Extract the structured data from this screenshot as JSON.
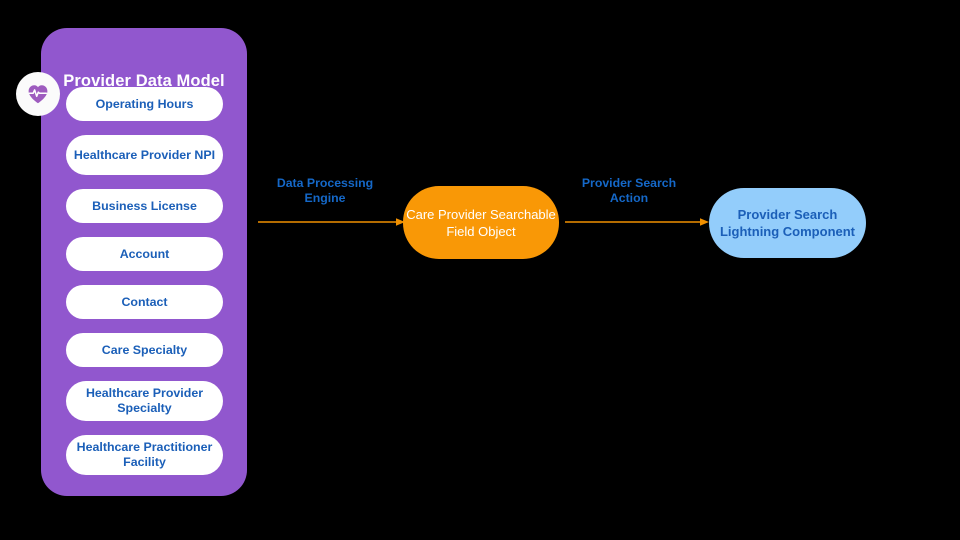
{
  "diagram": {
    "background_color": "#000000",
    "panel": {
      "title": "Provider Data Model",
      "color": "#9157ce",
      "badge_icon": "heart-pulse-icon",
      "items": [
        {
          "label": "Operating Hours",
          "lines": 1
        },
        {
          "label": "Healthcare Provider NPI",
          "lines": 2
        },
        {
          "label": "Business License",
          "lines": 1
        },
        {
          "label": "Account",
          "lines": 1
        },
        {
          "label": "Contact",
          "lines": 1
        },
        {
          "label": "Care Specialty",
          "lines": 1
        },
        {
          "label": "Healthcare Provider Specialty",
          "lines": 2
        },
        {
          "label": "Healthcare Practitioner Facility",
          "lines": 2
        }
      ],
      "item_text_color": "#1b5fb8",
      "item_fill": "#ffffff"
    },
    "nodes": [
      {
        "id": "care-provider-searchable-field-object",
        "label": "Care Provider Searchable Field Object",
        "color": "#f99806",
        "text_color": "#ffffff"
      },
      {
        "id": "provider-search-lightning-component",
        "label": "Provider Search Lightning Component",
        "color": "#93cdfb",
        "text_color": "#1b5fb8"
      }
    ],
    "connectors": [
      {
        "id": "data-processing-engine",
        "label": "Data Processing Engine",
        "color": "#f09000",
        "text_color": "#1568c8"
      },
      {
        "id": "provider-search-action",
        "label": "Provider Search Action",
        "color": "#f09000",
        "text_color": "#1568c8"
      }
    ]
  }
}
